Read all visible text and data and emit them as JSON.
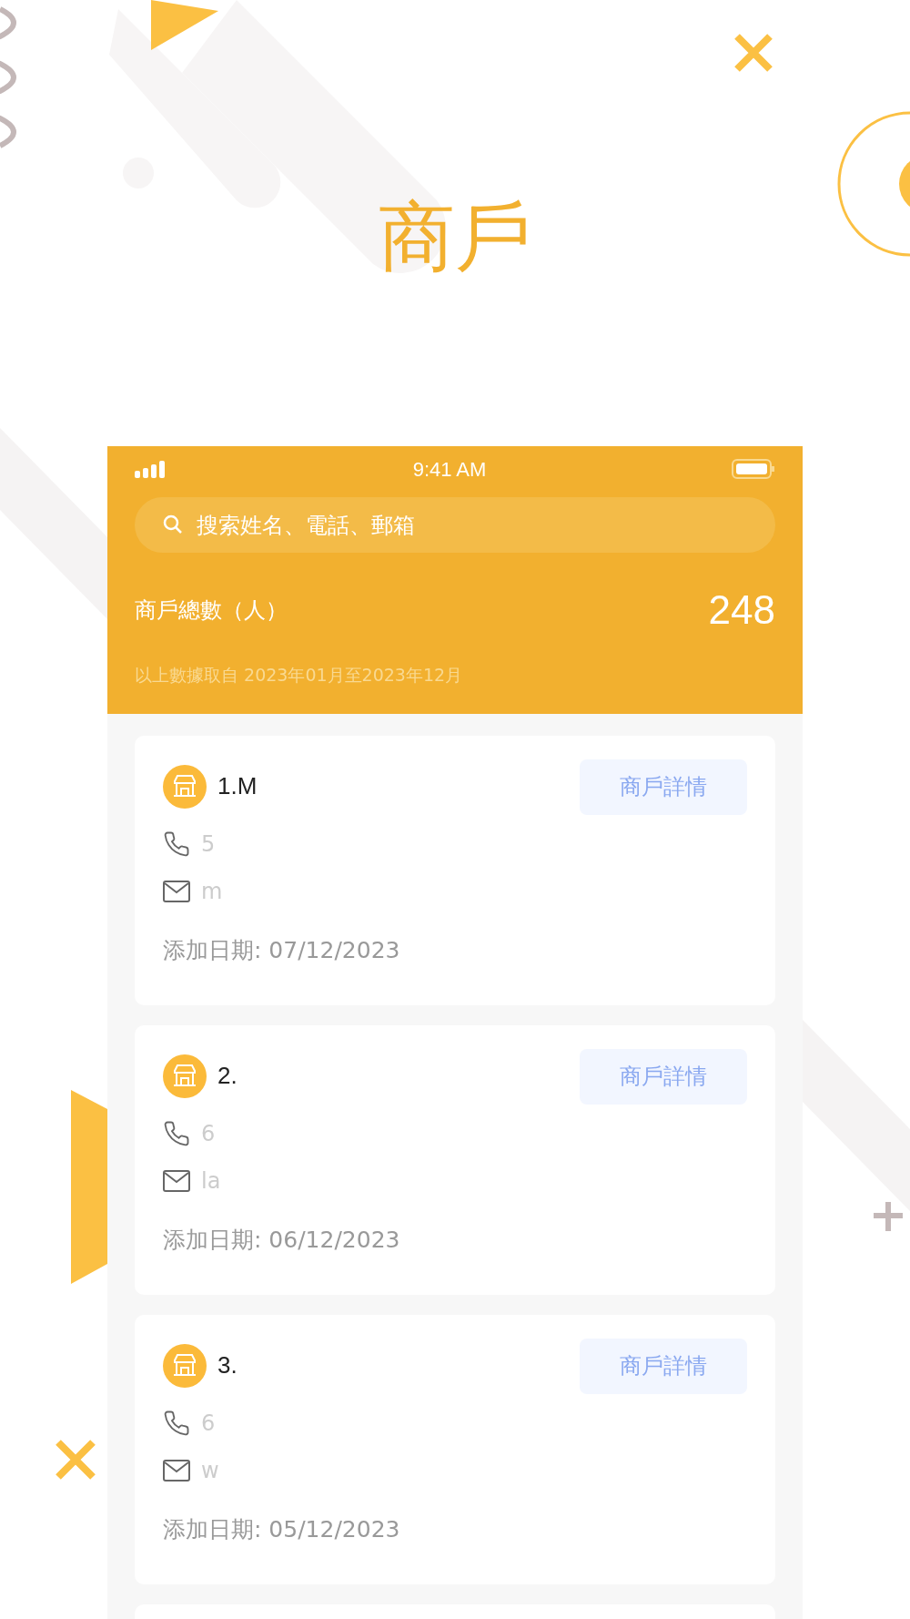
{
  "headline": "商戶",
  "status_bar": {
    "time": "9:41 AM"
  },
  "search": {
    "placeholder": "搜索姓名、電話、郵箱"
  },
  "summary": {
    "label": "商戶總數（人）",
    "value": "248",
    "note": "以上數據取自 2023年01月至2023年12月"
  },
  "merchants": [
    {
      "name": "1.M",
      "phone": "5",
      "email": "m",
      "date": "添加日期: 07/12/2023",
      "button": "商戶詳情"
    },
    {
      "name": "2.",
      "phone": "6",
      "email": "la",
      "date": "添加日期: 06/12/2023",
      "button": "商戶詳情"
    },
    {
      "name": "3.",
      "phone": "6",
      "email": "w",
      "date": "添加日期: 05/12/2023",
      "button": "商戶詳情"
    }
  ]
}
